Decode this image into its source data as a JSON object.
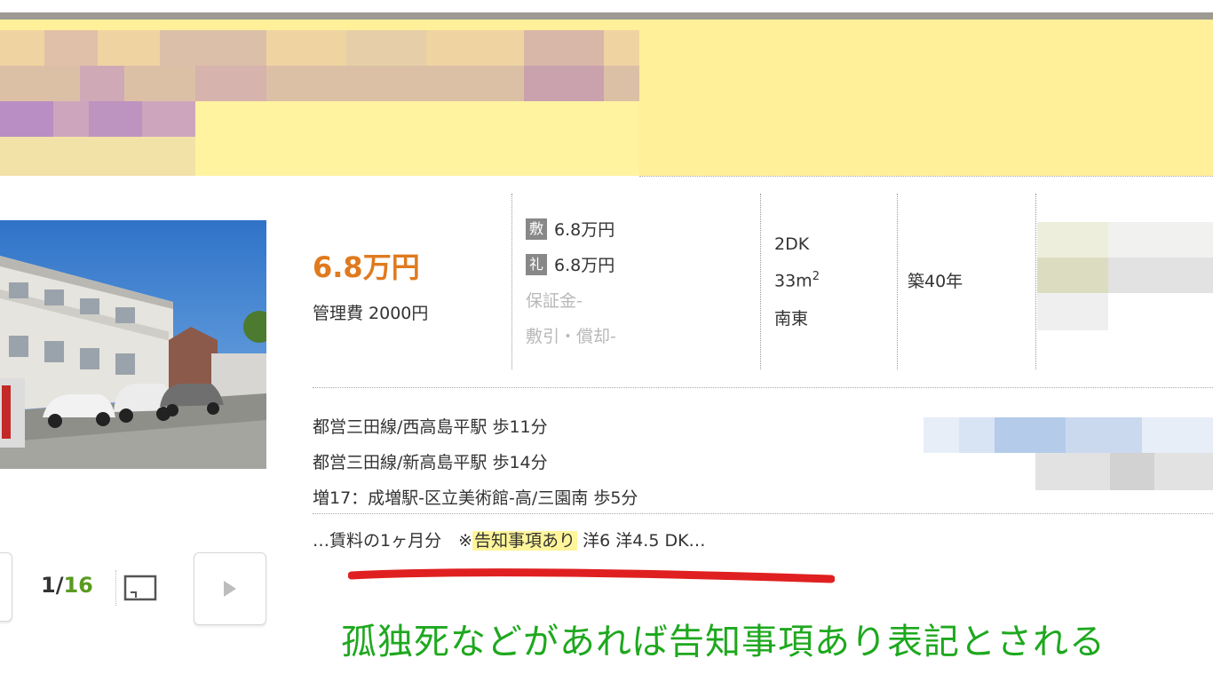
{
  "listing": {
    "rent": "6.8万円",
    "management_fee": "管理費 2000円",
    "fees": {
      "deposit_tag": "敷",
      "deposit_value": "6.8万円",
      "key_money_tag": "礼",
      "key_money_value": "6.8万円",
      "guarantee": "保証金-",
      "deduction": "敷引・償却-"
    },
    "layout": "2DK",
    "area": "33m",
    "area_sup": "2",
    "direction": "南東",
    "age": "築40年",
    "access": [
      "都営三田線/西高島平駅 歩11分",
      "都営三田線/新高島平駅 歩14分",
      "増17：成増駅-区立美術館-高/三園南 歩5分"
    ],
    "note_prefix": "…賃料の1ヶ月分　※",
    "note_highlight": "告知事項あり",
    "note_suffix": " 洋6 洋4.5 DK…"
  },
  "gallery": {
    "current": "1/",
    "total": "16"
  },
  "annotation": "孤独死などがあれば告知事項あり表記とされる",
  "colors": {
    "rent": "#e07a1e",
    "header_band": "#fff099",
    "highlight": "#fff59a",
    "annotation": "#1ea81e",
    "underline": "#e02020",
    "counter_total": "#5a9a20"
  }
}
